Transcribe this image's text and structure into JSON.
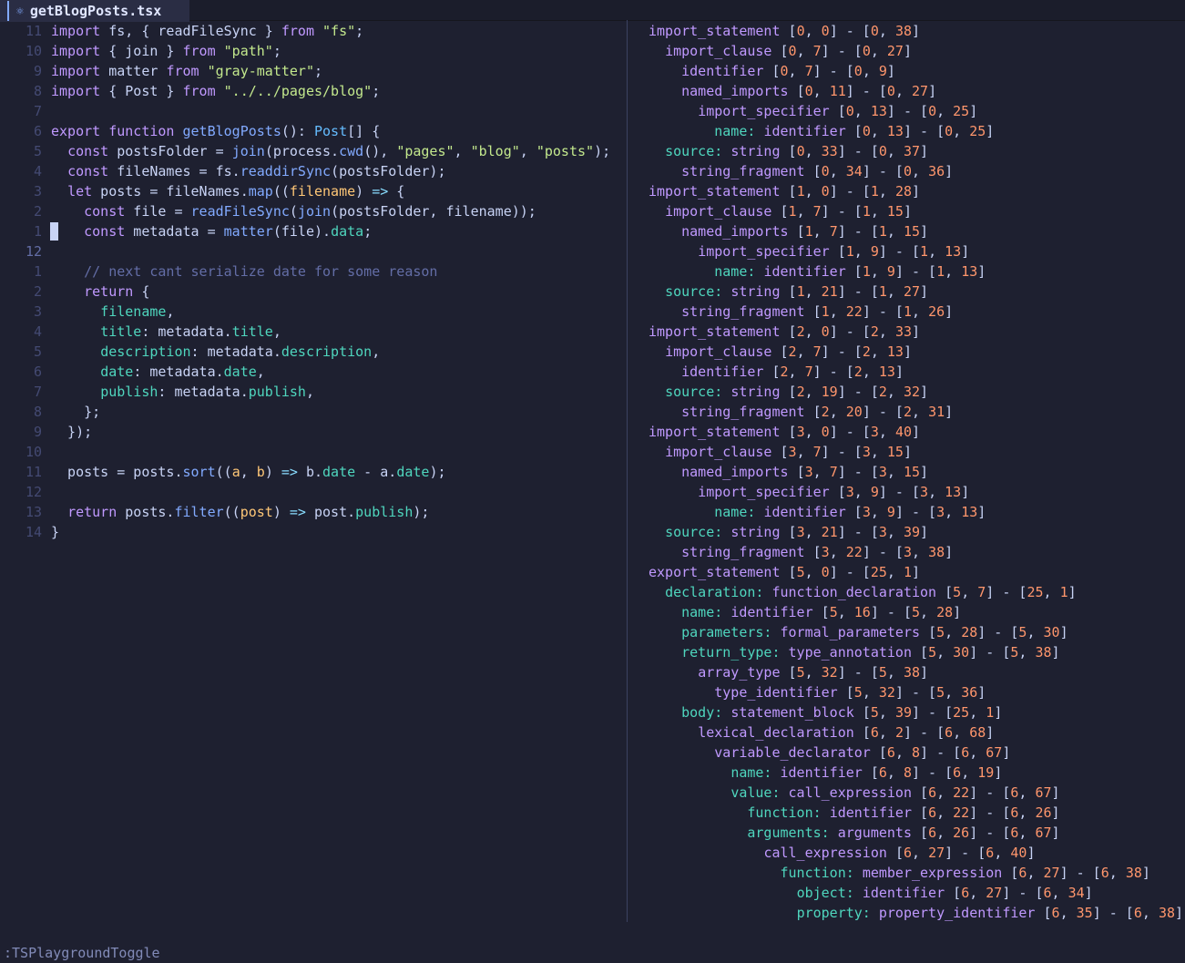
{
  "tab": {
    "title": "getBlogPosts.tsx"
  },
  "editor": {
    "lines": [
      {
        "num": "11",
        "tokens": [
          [
            "k",
            "import"
          ],
          [
            "v",
            " fs, { readFileSync } "
          ],
          [
            "k",
            "from"
          ],
          [
            "v",
            " "
          ],
          [
            "s",
            "\"fs\""
          ],
          [
            "v",
            ";"
          ]
        ]
      },
      {
        "num": "10",
        "tokens": [
          [
            "k",
            "import"
          ],
          [
            "v",
            " { join } "
          ],
          [
            "k",
            "from"
          ],
          [
            "v",
            " "
          ],
          [
            "s",
            "\"path\""
          ],
          [
            "v",
            ";"
          ]
        ]
      },
      {
        "num": "9",
        "tokens": [
          [
            "k",
            "import"
          ],
          [
            "v",
            " matter "
          ],
          [
            "k",
            "from"
          ],
          [
            "v",
            " "
          ],
          [
            "s",
            "\"gray-matter\""
          ],
          [
            "v",
            ";"
          ]
        ]
      },
      {
        "num": "8",
        "tokens": [
          [
            "k",
            "import"
          ],
          [
            "v",
            " { Post } "
          ],
          [
            "k",
            "from"
          ],
          [
            "v",
            " "
          ],
          [
            "s",
            "\"../../pages/blog\""
          ],
          [
            "v",
            ";"
          ]
        ]
      },
      {
        "num": "7",
        "tokens": []
      },
      {
        "num": "6",
        "tokens": [
          [
            "k",
            "export"
          ],
          [
            "v",
            " "
          ],
          [
            "k",
            "function"
          ],
          [
            "v",
            " "
          ],
          [
            "f",
            "getBlogPosts"
          ],
          [
            "v",
            "(): "
          ],
          [
            "t",
            "Post"
          ],
          [
            "v",
            "[] {"
          ]
        ]
      },
      {
        "num": "5",
        "tokens": [
          [
            "v",
            "  "
          ],
          [
            "k",
            "const"
          ],
          [
            "v",
            " postsFolder = "
          ],
          [
            "f",
            "join"
          ],
          [
            "v",
            "(process."
          ],
          [
            "f",
            "cwd"
          ],
          [
            "v",
            "(), "
          ],
          [
            "s",
            "\"pages\""
          ],
          [
            "v",
            ", "
          ],
          [
            "s",
            "\"blog\""
          ],
          [
            "v",
            ", "
          ],
          [
            "s",
            "\"posts\""
          ],
          [
            "v",
            ");"
          ]
        ]
      },
      {
        "num": "4",
        "tokens": [
          [
            "v",
            "  "
          ],
          [
            "k",
            "const"
          ],
          [
            "v",
            " fileNames = fs."
          ],
          [
            "f",
            "readdirSync"
          ],
          [
            "v",
            "(postsFolder);"
          ]
        ]
      },
      {
        "num": "3",
        "tokens": [
          [
            "v",
            "  "
          ],
          [
            "k",
            "let"
          ],
          [
            "v",
            " posts = fileNames."
          ],
          [
            "f",
            "map"
          ],
          [
            "v",
            "(("
          ],
          [
            "p",
            "filename"
          ],
          [
            "v",
            ") "
          ],
          [
            "o",
            "=>"
          ],
          [
            "v",
            " {"
          ]
        ]
      },
      {
        "num": "2",
        "tokens": [
          [
            "v",
            "    "
          ],
          [
            "k",
            "const"
          ],
          [
            "v",
            " file = "
          ],
          [
            "f",
            "readFileSync"
          ],
          [
            "v",
            "("
          ],
          [
            "f",
            "join"
          ],
          [
            "v",
            "(postsFolder, filename));"
          ]
        ]
      },
      {
        "num": "1",
        "tokens": [
          [
            "v",
            "    "
          ],
          [
            "k",
            "const"
          ],
          [
            "v",
            " metadata = "
          ],
          [
            "f",
            "matter"
          ],
          [
            "v",
            "(file)."
          ],
          [
            "pr",
            "data"
          ],
          [
            "v",
            ";"
          ]
        ]
      },
      {
        "num": "12",
        "current": true,
        "tokens": []
      },
      {
        "num": "1",
        "tokens": [
          [
            "v",
            "    "
          ],
          [
            "c",
            "// next cant serialize date for some reason"
          ]
        ]
      },
      {
        "num": "2",
        "tokens": [
          [
            "v",
            "    "
          ],
          [
            "k",
            "return"
          ],
          [
            "v",
            " {"
          ]
        ]
      },
      {
        "num": "3",
        "tokens": [
          [
            "v",
            "      "
          ],
          [
            "pr",
            "filename"
          ],
          [
            "v",
            ","
          ]
        ]
      },
      {
        "num": "4",
        "tokens": [
          [
            "v",
            "      "
          ],
          [
            "pr",
            "title"
          ],
          [
            "v",
            ": metadata."
          ],
          [
            "pr",
            "title"
          ],
          [
            "v",
            ","
          ]
        ]
      },
      {
        "num": "5",
        "tokens": [
          [
            "v",
            "      "
          ],
          [
            "pr",
            "description"
          ],
          [
            "v",
            ": metadata."
          ],
          [
            "pr",
            "description"
          ],
          [
            "v",
            ","
          ]
        ]
      },
      {
        "num": "6",
        "tokens": [
          [
            "v",
            "      "
          ],
          [
            "pr",
            "date"
          ],
          [
            "v",
            ": metadata."
          ],
          [
            "pr",
            "date"
          ],
          [
            "v",
            ","
          ]
        ]
      },
      {
        "num": "7",
        "tokens": [
          [
            "v",
            "      "
          ],
          [
            "pr",
            "publish"
          ],
          [
            "v",
            ": metadata."
          ],
          [
            "pr",
            "publish"
          ],
          [
            "v",
            ","
          ]
        ]
      },
      {
        "num": "8",
        "tokens": [
          [
            "v",
            "    };"
          ]
        ]
      },
      {
        "num": "9",
        "tokens": [
          [
            "v",
            "  });"
          ]
        ]
      },
      {
        "num": "10",
        "tokens": []
      },
      {
        "num": "11",
        "tokens": [
          [
            "v",
            "  posts = posts."
          ],
          [
            "f",
            "sort"
          ],
          [
            "v",
            "(("
          ],
          [
            "p",
            "a"
          ],
          [
            "v",
            ", "
          ],
          [
            "p",
            "b"
          ],
          [
            "v",
            ") "
          ],
          [
            "o",
            "=>"
          ],
          [
            "v",
            " b."
          ],
          [
            "pr",
            "date"
          ],
          [
            "v",
            " - a."
          ],
          [
            "pr",
            "date"
          ],
          [
            "v",
            ");"
          ]
        ]
      },
      {
        "num": "12",
        "tokens": []
      },
      {
        "num": "13",
        "tokens": [
          [
            "v",
            "  "
          ],
          [
            "k",
            "return"
          ],
          [
            "v",
            " posts."
          ],
          [
            "f",
            "filter"
          ],
          [
            "v",
            "(("
          ],
          [
            "p",
            "post"
          ],
          [
            "v",
            ") "
          ],
          [
            "o",
            "=>"
          ],
          [
            "v",
            " post."
          ],
          [
            "pr",
            "publish"
          ],
          [
            "v",
            ");"
          ]
        ]
      },
      {
        "num": "14",
        "tokens": [
          [
            "v",
            "}"
          ]
        ]
      }
    ]
  },
  "tree": {
    "lines": [
      {
        "depth": 0,
        "node": "import_statement",
        "range": "[0, 0] - [0, 38]"
      },
      {
        "depth": 1,
        "node": "import_clause",
        "range": "[0, 7] - [0, 27]"
      },
      {
        "depth": 2,
        "node": "identifier",
        "range": "[0, 7] - [0, 9]"
      },
      {
        "depth": 2,
        "node": "named_imports",
        "range": "[0, 11] - [0, 27]"
      },
      {
        "depth": 3,
        "node": "import_specifier",
        "range": "[0, 13] - [0, 25]"
      },
      {
        "depth": 4,
        "field": "name",
        "node": "identifier",
        "range": "[0, 13] - [0, 25]"
      },
      {
        "depth": 1,
        "field": "source",
        "node": "string",
        "range": "[0, 33] - [0, 37]"
      },
      {
        "depth": 2,
        "node": "string_fragment",
        "range": "[0, 34] - [0, 36]"
      },
      {
        "depth": 0,
        "node": "import_statement",
        "range": "[1, 0] - [1, 28]"
      },
      {
        "depth": 1,
        "node": "import_clause",
        "range": "[1, 7] - [1, 15]"
      },
      {
        "depth": 2,
        "node": "named_imports",
        "range": "[1, 7] - [1, 15]"
      },
      {
        "depth": 3,
        "node": "import_specifier",
        "range": "[1, 9] - [1, 13]"
      },
      {
        "depth": 4,
        "field": "name",
        "node": "identifier",
        "range": "[1, 9] - [1, 13]"
      },
      {
        "depth": 1,
        "field": "source",
        "node": "string",
        "range": "[1, 21] - [1, 27]"
      },
      {
        "depth": 2,
        "node": "string_fragment",
        "range": "[1, 22] - [1, 26]"
      },
      {
        "depth": 0,
        "node": "import_statement",
        "range": "[2, 0] - [2, 33]"
      },
      {
        "depth": 1,
        "node": "import_clause",
        "range": "[2, 7] - [2, 13]"
      },
      {
        "depth": 2,
        "node": "identifier",
        "range": "[2, 7] - [2, 13]"
      },
      {
        "depth": 1,
        "field": "source",
        "node": "string",
        "range": "[2, 19] - [2, 32]"
      },
      {
        "depth": 2,
        "node": "string_fragment",
        "range": "[2, 20] - [2, 31]"
      },
      {
        "depth": 0,
        "node": "import_statement",
        "range": "[3, 0] - [3, 40]"
      },
      {
        "depth": 1,
        "node": "import_clause",
        "range": "[3, 7] - [3, 15]"
      },
      {
        "depth": 2,
        "node": "named_imports",
        "range": "[3, 7] - [3, 15]"
      },
      {
        "depth": 3,
        "node": "import_specifier",
        "range": "[3, 9] - [3, 13]"
      },
      {
        "depth": 4,
        "field": "name",
        "node": "identifier",
        "range": "[3, 9] - [3, 13]"
      },
      {
        "depth": 1,
        "field": "source",
        "node": "string",
        "range": "[3, 21] - [3, 39]"
      },
      {
        "depth": 2,
        "node": "string_fragment",
        "range": "[3, 22] - [3, 38]"
      },
      {
        "depth": 0,
        "node": "export_statement",
        "range": "[5, 0] - [25, 1]"
      },
      {
        "depth": 1,
        "field": "declaration",
        "node": "function_declaration",
        "range": "[5, 7] - [25, 1]"
      },
      {
        "depth": 2,
        "field": "name",
        "node": "identifier",
        "range": "[5, 16] - [5, 28]"
      },
      {
        "depth": 2,
        "field": "parameters",
        "node": "formal_parameters",
        "range": "[5, 28] - [5, 30]"
      },
      {
        "depth": 2,
        "field": "return_type",
        "node": "type_annotation",
        "range": "[5, 30] - [5, 38]"
      },
      {
        "depth": 3,
        "node": "array_type",
        "range": "[5, 32] - [5, 38]"
      },
      {
        "depth": 4,
        "node": "type_identifier",
        "range": "[5, 32] - [5, 36]"
      },
      {
        "depth": 2,
        "field": "body",
        "node": "statement_block",
        "range": "[5, 39] - [25, 1]"
      },
      {
        "depth": 3,
        "node": "lexical_declaration",
        "range": "[6, 2] - [6, 68]"
      },
      {
        "depth": 4,
        "node": "variable_declarator",
        "range": "[6, 8] - [6, 67]"
      },
      {
        "depth": 5,
        "field": "name",
        "node": "identifier",
        "range": "[6, 8] - [6, 19]"
      },
      {
        "depth": 5,
        "field": "value",
        "node": "call_expression",
        "range": "[6, 22] - [6, 67]"
      },
      {
        "depth": 6,
        "field": "function",
        "node": "identifier",
        "range": "[6, 22] - [6, 26]"
      },
      {
        "depth": 6,
        "field": "arguments",
        "node": "arguments",
        "range": "[6, 26] - [6, 67]"
      },
      {
        "depth": 7,
        "node": "call_expression",
        "range": "[6, 27] - [6, 40]"
      },
      {
        "depth": 8,
        "field": "function",
        "node": "member_expression",
        "range": "[6, 27] - [6, 38]"
      },
      {
        "depth": 9,
        "field": "object",
        "node": "identifier",
        "range": "[6, 27] - [6, 34]"
      },
      {
        "depth": 9,
        "field": "property",
        "node": "property_identifier",
        "range": "[6, 35] - [6, 38]"
      }
    ]
  },
  "cmdline": ":TSPlaygroundToggle"
}
